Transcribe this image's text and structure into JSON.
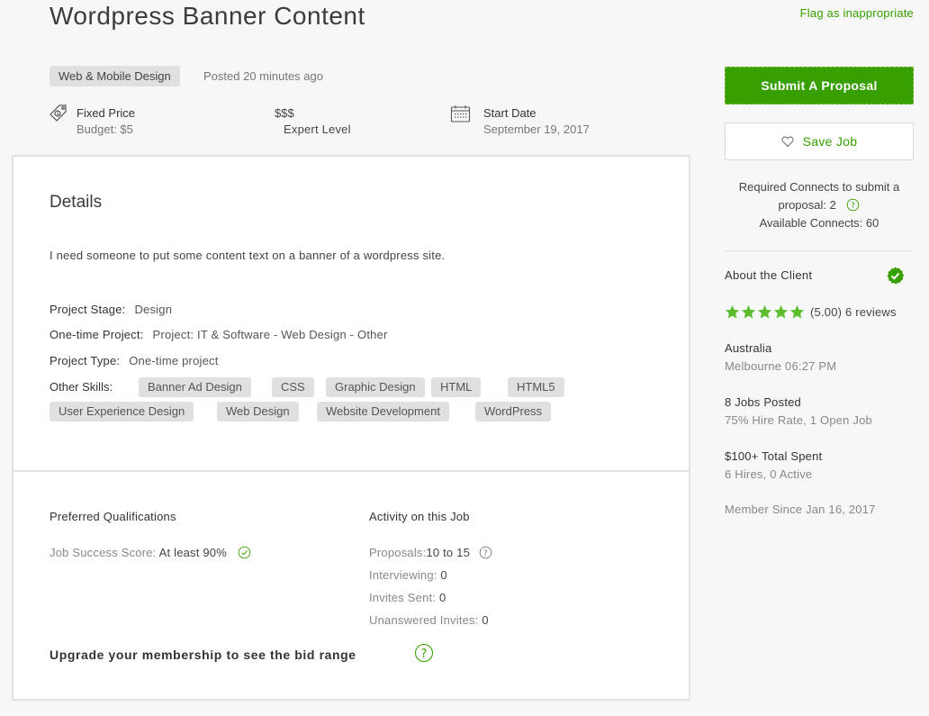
{
  "header": {
    "title": "Wordpress Banner Content",
    "flag_link": "Flag as inappropriate"
  },
  "meta": {
    "category": "Web & Mobile Design",
    "posted": "Posted 20 minutes ago",
    "price_type": "Fixed Price",
    "budget": "Budget: $5",
    "level_symbol": "$$$",
    "level": "Expert Level",
    "start_label": "Start Date",
    "start_date": "September 19, 2017"
  },
  "details": {
    "heading": "Details",
    "description": "I need someone to put some content text on a banner of a wordpress site.",
    "fields": [
      {
        "label": "Project Stage:",
        "value": "Design"
      },
      {
        "label": "One-time Project:",
        "value": "Project: IT & Software - Web Design - Other"
      },
      {
        "label": "Project Type:",
        "value": "One-time project"
      }
    ],
    "skills_label": "Other Skills:",
    "skills": [
      "Banner Ad Design",
      "CSS",
      "Graphic Design",
      "HTML",
      "HTML5",
      "User Experience Design",
      "Web Design",
      "Website Development",
      "WordPress"
    ]
  },
  "qualifications": {
    "heading": "Preferred Qualifications",
    "jss_label": "Job Success Score:",
    "jss_value": "At least 90%"
  },
  "activity": {
    "heading": "Activity on this Job",
    "proposals_label": "Proposals:",
    "proposals_value": "10 to 15",
    "interviewing_label": "Interviewing:",
    "interviewing_value": "0",
    "invites_label": "Invites Sent:",
    "invites_value": "0",
    "unanswered_label": "Unanswered Invites:",
    "unanswered_value": "0"
  },
  "upgrade_text": "Upgrade your membership to see the bid range",
  "sidebar": {
    "submit_label": "Submit A Proposal",
    "save_label": "Save Job",
    "required_connects": "Required Connects to submit a proposal: 2",
    "available_connects": "Available Connects: 60",
    "about_client": "About the Client",
    "rating": 5.0,
    "rating_text": "(5.00) 6 reviews",
    "country": "Australia",
    "city_time": "Melbourne 06:27 PM",
    "jobs_posted": "8 Jobs Posted",
    "hire_rate": "75% Hire Rate, 1 Open Job",
    "total_spent": "$100+ Total Spent",
    "hires": "6 Hires, 0 Active",
    "member_since": "Member Since Jan 16, 2017"
  },
  "colors": {
    "accent": "#37a000",
    "star": "#5bbd2c",
    "chip_bg": "#e0e0e0"
  }
}
